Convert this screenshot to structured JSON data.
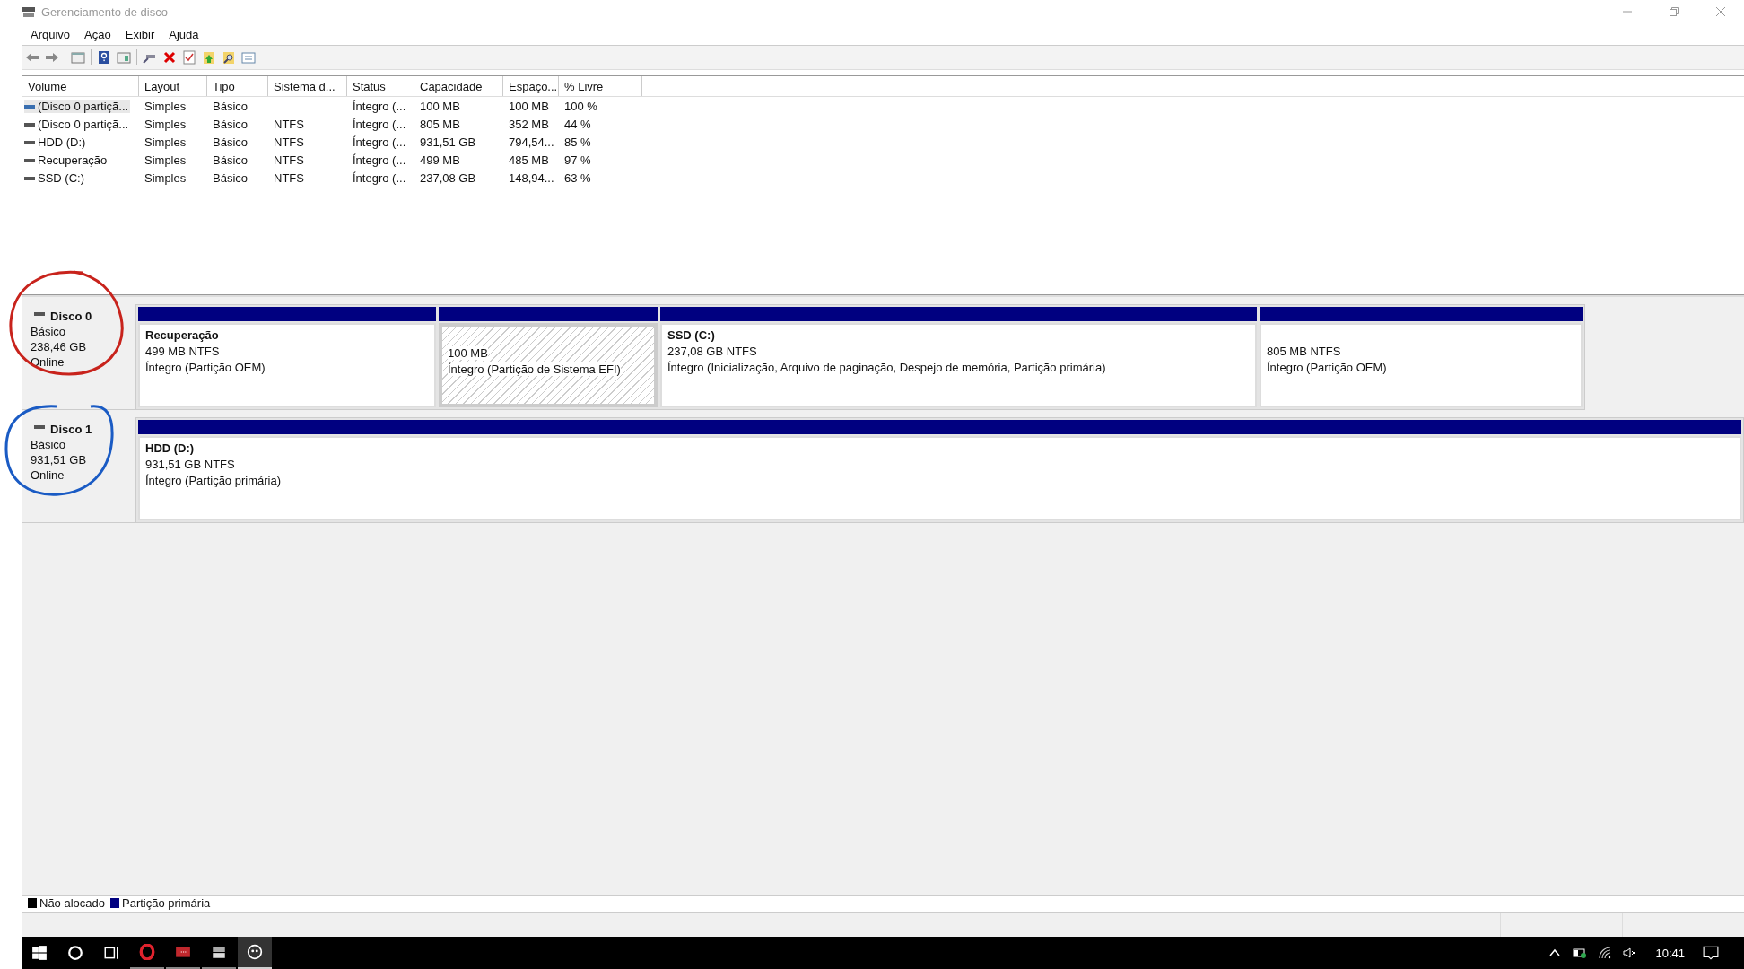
{
  "window": {
    "title": "Gerenciamento de disco"
  },
  "menu": [
    "Arquivo",
    "Ação",
    "Exibir",
    "Ajuda"
  ],
  "table": {
    "columns": [
      "Volume",
      "Layout",
      "Tipo",
      "Sistema d...",
      "Status",
      "Capacidade",
      "Espaço...",
      "% Livre"
    ],
    "rows": [
      {
        "selected": true,
        "cells": [
          "(Disco 0 partiçã...",
          "Simples",
          "Básico",
          "",
          "Íntegro (...",
          "100 MB",
          "100 MB",
          "100 %"
        ]
      },
      {
        "selected": false,
        "cells": [
          "(Disco 0 partiçã...",
          "Simples",
          "Básico",
          "NTFS",
          "Íntegro (...",
          "805 MB",
          "352 MB",
          "44 %"
        ]
      },
      {
        "selected": false,
        "cells": [
          "HDD (D:)",
          "Simples",
          "Básico",
          "NTFS",
          "Íntegro (...",
          "931,51 GB",
          "794,54...",
          "85 %"
        ]
      },
      {
        "selected": false,
        "cells": [
          "Recuperação",
          "Simples",
          "Básico",
          "NTFS",
          "Íntegro (...",
          "499 MB",
          "485 MB",
          "97 %"
        ]
      },
      {
        "selected": false,
        "cells": [
          "SSD (C:)",
          "Simples",
          "Básico",
          "NTFS",
          "Íntegro (...",
          "237,08 GB",
          "148,94...",
          "63 %"
        ]
      }
    ]
  },
  "disks": [
    {
      "name": "Disco 0",
      "type": "Básico",
      "size": "238,46 GB",
      "state": "Online",
      "partitions": [
        {
          "kind": "normal",
          "name": "Recuperação",
          "size": "499 MB NTFS",
          "status": "Íntegro (Partição OEM)"
        },
        {
          "kind": "hatched",
          "size": "100 MB",
          "status": "Íntegro (Partição de Sistema EFI)"
        },
        {
          "kind": "normal",
          "name": "SSD  (C:)",
          "size": "237,08 GB NTFS",
          "status": "Íntegro (Inicialização, Arquivo de paginação, Despejo de memória, Partição primária)"
        },
        {
          "kind": "normal",
          "size": "805 MB NTFS",
          "status": "Íntegro (Partição OEM)"
        }
      ]
    },
    {
      "name": "Disco 1",
      "type": "Básico",
      "size": "931,51 GB",
      "state": "Online",
      "partitions": [
        {
          "kind": "normal",
          "name": "HDD  (D:)",
          "size": "931,51 GB NTFS",
          "status": "Íntegro (Partição primária)"
        }
      ]
    }
  ],
  "legend": [
    {
      "label": "Não alocado",
      "color": "#000000"
    },
    {
      "label": "Partição primária",
      "color": "#000080"
    }
  ],
  "taskbar": {
    "apps": [
      {
        "kind": "opera",
        "selected": false
      },
      {
        "kind": "redapp",
        "selected": false
      },
      {
        "kind": "disk",
        "selected": false
      },
      {
        "kind": "paint",
        "selected": true
      }
    ],
    "time": "10:41"
  }
}
